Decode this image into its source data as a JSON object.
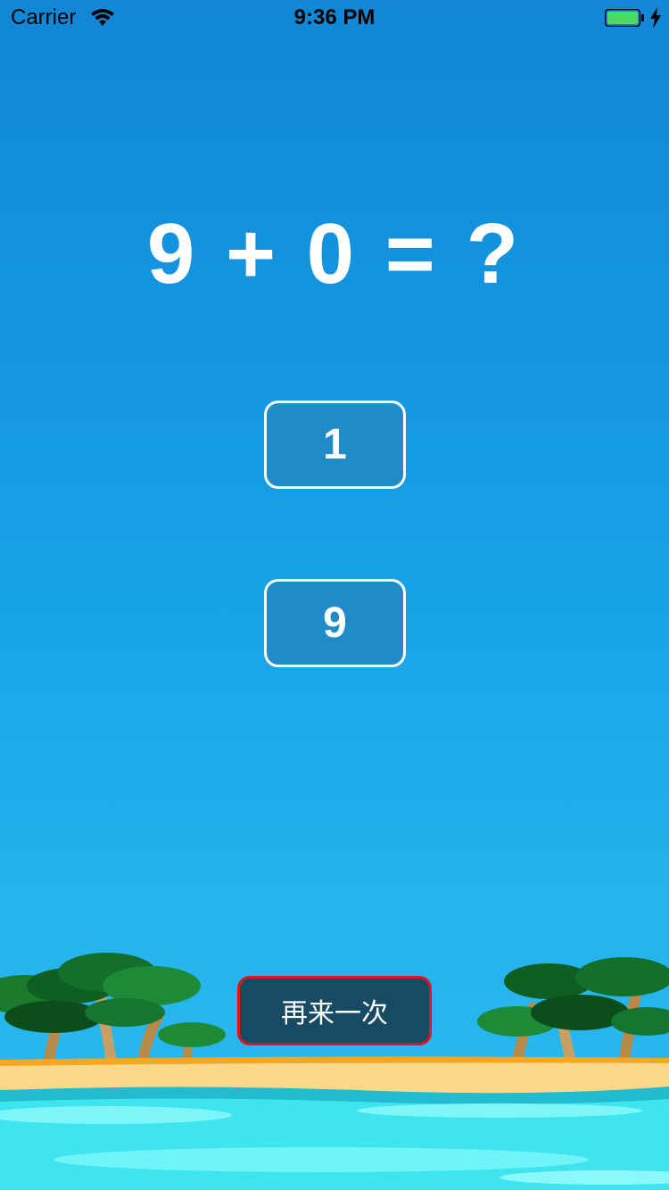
{
  "status_bar": {
    "carrier": "Carrier",
    "time": "9:36 PM",
    "icons": [
      "wifi-icon",
      "battery-icon",
      "charging-bolt-icon"
    ]
  },
  "quiz": {
    "question": "9 + 0 = ?",
    "answers": [
      "1",
      "9"
    ]
  },
  "actions": {
    "retry_label": "再来一次"
  },
  "colors": {
    "sky_top": "#1187d6",
    "sky_bottom": "#2ab8ee",
    "answer_button_bg": "#1f8bc7",
    "retry_button_bg": "#174b63",
    "retry_button_border": "#e0141e",
    "battery_fill": "#4cd964"
  }
}
